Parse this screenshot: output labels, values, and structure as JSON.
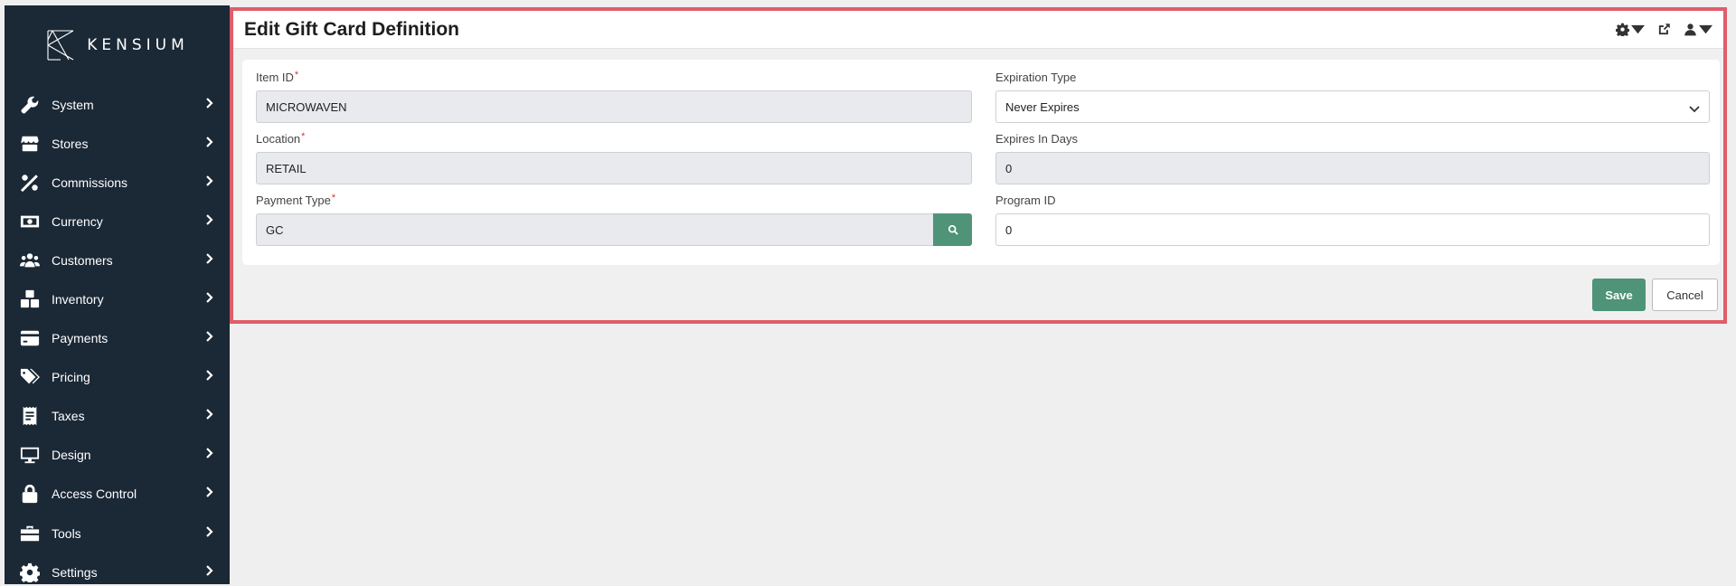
{
  "brand": {
    "name": "KENSIUM"
  },
  "sidebar": {
    "items": [
      {
        "label": "System",
        "icon": "wrench-icon"
      },
      {
        "label": "Stores",
        "icon": "store-icon"
      },
      {
        "label": "Commissions",
        "icon": "percent-icon"
      },
      {
        "label": "Currency",
        "icon": "money-bill-icon"
      },
      {
        "label": "Customers",
        "icon": "users-icon"
      },
      {
        "label": "Inventory",
        "icon": "boxes-icon"
      },
      {
        "label": "Payments",
        "icon": "credit-card-icon"
      },
      {
        "label": "Pricing",
        "icon": "tags-icon"
      },
      {
        "label": "Taxes",
        "icon": "receipt-icon"
      },
      {
        "label": "Design",
        "icon": "monitor-icon"
      },
      {
        "label": "Access Control",
        "icon": "lock-icon"
      },
      {
        "label": "Tools",
        "icon": "toolbox-icon"
      },
      {
        "label": "Settings",
        "icon": "gear-icon"
      }
    ]
  },
  "header": {
    "title": "Edit Gift Card Definition",
    "icons": [
      "settings-gear-icon",
      "external-link-icon",
      "user-icon"
    ]
  },
  "form": {
    "item_id": {
      "label": "Item ID",
      "value": "MICROWAVEN",
      "required": true
    },
    "location": {
      "label": "Location",
      "value": "RETAIL",
      "required": true
    },
    "payment_type": {
      "label": "Payment Type",
      "value": "GC",
      "required": true
    },
    "expiration_type": {
      "label": "Expiration Type",
      "value": "Never Expires"
    },
    "expires_in_days": {
      "label": "Expires In Days",
      "value": "0"
    },
    "program_id": {
      "label": "Program ID",
      "value": "0"
    },
    "required_mark": "*"
  },
  "actions": {
    "save_label": "Save",
    "cancel_label": "Cancel"
  },
  "colors": {
    "sidebar_bg": "#1b2836",
    "accent": "#4f9379",
    "highlight_border": "#e05d6a"
  }
}
